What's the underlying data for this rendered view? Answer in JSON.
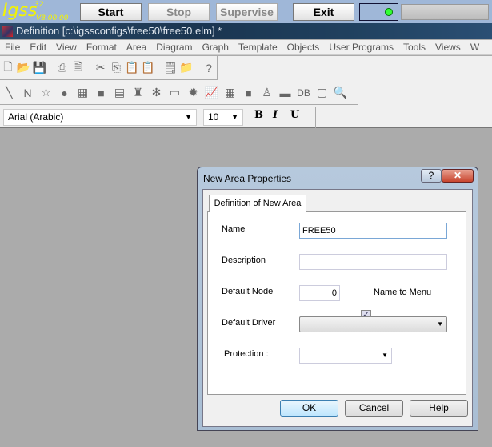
{
  "top": {
    "logo": "Igss",
    "logo_sup": "32",
    "version": "V8.00.00",
    "start": "Start",
    "stop": "Stop",
    "supervise": "Supervise",
    "exit": "Exit",
    "status_color": "#33ff33"
  },
  "title": "Definition [c:\\igssconfigs\\free50\\free50.elm] *",
  "menu": [
    "File",
    "Edit",
    "View",
    "Format",
    "Area",
    "Diagram",
    "Graph",
    "Template",
    "Objects",
    "User Programs",
    "Tools",
    "Views",
    "W"
  ],
  "toolbar1": [
    "new-file-icon",
    "open-folder-icon",
    "save-icon",
    "|",
    "print-icon",
    "print-preview-icon",
    "|",
    "cut-icon",
    "copy-icon",
    "paste-special-icon",
    "paste-icon",
    "|",
    "properties-icon",
    "open-config-icon",
    "|",
    "context-help-icon"
  ],
  "toolbar2": [
    "line-icon",
    "polyline-icon",
    "star-icon",
    "circle-icon",
    "grid-icon",
    "rectangle-icon",
    "text-box-icon",
    "bin-icon",
    "valve-icon",
    "screen-icon",
    "gear-icon",
    "graph-icon",
    "table-icon",
    "block-icon",
    "alarm-icon",
    "button-icon",
    "db-icon",
    "xyz-icon",
    "zoom-icon"
  ],
  "fontbar": {
    "font": "Arial (Arabic)",
    "size": "10",
    "bold": "B",
    "italic": "I",
    "underline": "U"
  },
  "dialog": {
    "title": "New Area Properties",
    "help": "?",
    "close": "✕",
    "tab": "Definition of New Area",
    "name_label": "Name",
    "name_value": "FREE50",
    "description_label": "Description",
    "description_value": "",
    "node_label": "Default Node",
    "node_value": "0",
    "name_to_menu": "Name to Menu",
    "name_to_menu_checked": true,
    "driver_label": "Default Driver",
    "driver_value": "",
    "protection_label": "Protection :",
    "protection_value": "",
    "ok": "OK",
    "cancel": "Cancel",
    "help_button": "Help"
  }
}
